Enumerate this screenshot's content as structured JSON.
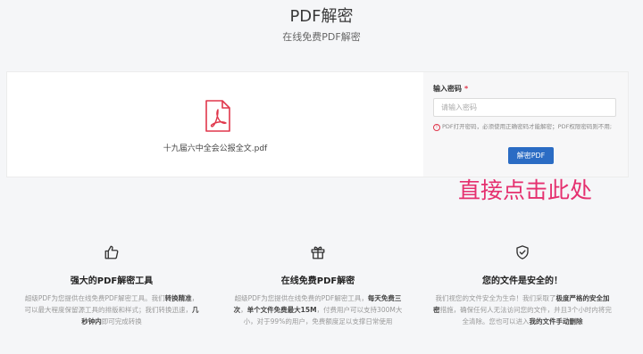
{
  "header": {
    "title": "PDF解密",
    "subtitle": "在线免费PDF解密"
  },
  "file": {
    "name": "十九届六中全会公报全文.pdf",
    "icon": "pdf-file-icon"
  },
  "form": {
    "password_label": "输入密码",
    "required_mark": "*",
    "password_placeholder": "请输入密码",
    "password_value": "",
    "hint": "PDF打开密码，必须使用正确密码才能解密；PDF权限密码则不用;",
    "decrypt_button": "解密PDF"
  },
  "annotation": {
    "text": "直接点击此处",
    "color": "#e5306f"
  },
  "features": [
    {
      "icon": "thumbs-up-icon",
      "title": "强大的PDF解密工具",
      "desc": [
        {
          "t": "超级PDF为您提供在线免费PDF解密工具。我们"
        },
        {
          "t": "转换精准",
          "b": true
        },
        {
          "t": "，可以最大程度保留源工具的排版和样式；我们转换迅速，"
        },
        {
          "t": "几秒钟内",
          "b": true
        },
        {
          "t": "即可完成转换"
        }
      ]
    },
    {
      "icon": "gift-icon",
      "title": "在线免费PDF解密",
      "desc": [
        {
          "t": "超级PDF为您提供在线免费的PDF解密工具，"
        },
        {
          "t": "每天免费三次",
          "b": true
        },
        {
          "t": "，"
        },
        {
          "t": "单个文件免费最大15M",
          "b": true
        },
        {
          "t": "，付费用户可以支持300M大小，对于99%的用户，免费额度足以支撑日常使用"
        }
      ]
    },
    {
      "icon": "shield-check-icon",
      "title": "您的文件是安全的！",
      "desc": [
        {
          "t": "我们视您的文件安全为生命！我们采取了"
        },
        {
          "t": "极度严格的安全加密",
          "b": true
        },
        {
          "t": "措施，确保任何人无法访问您的文件，并且3个小时内将完全清除。您也可以进入"
        },
        {
          "t": "我的文件手动删除",
          "b": true
        }
      ]
    }
  ],
  "colors": {
    "accent": "#2b6cc4",
    "pdf_red": "#e0364b",
    "required": "#e0364b"
  }
}
